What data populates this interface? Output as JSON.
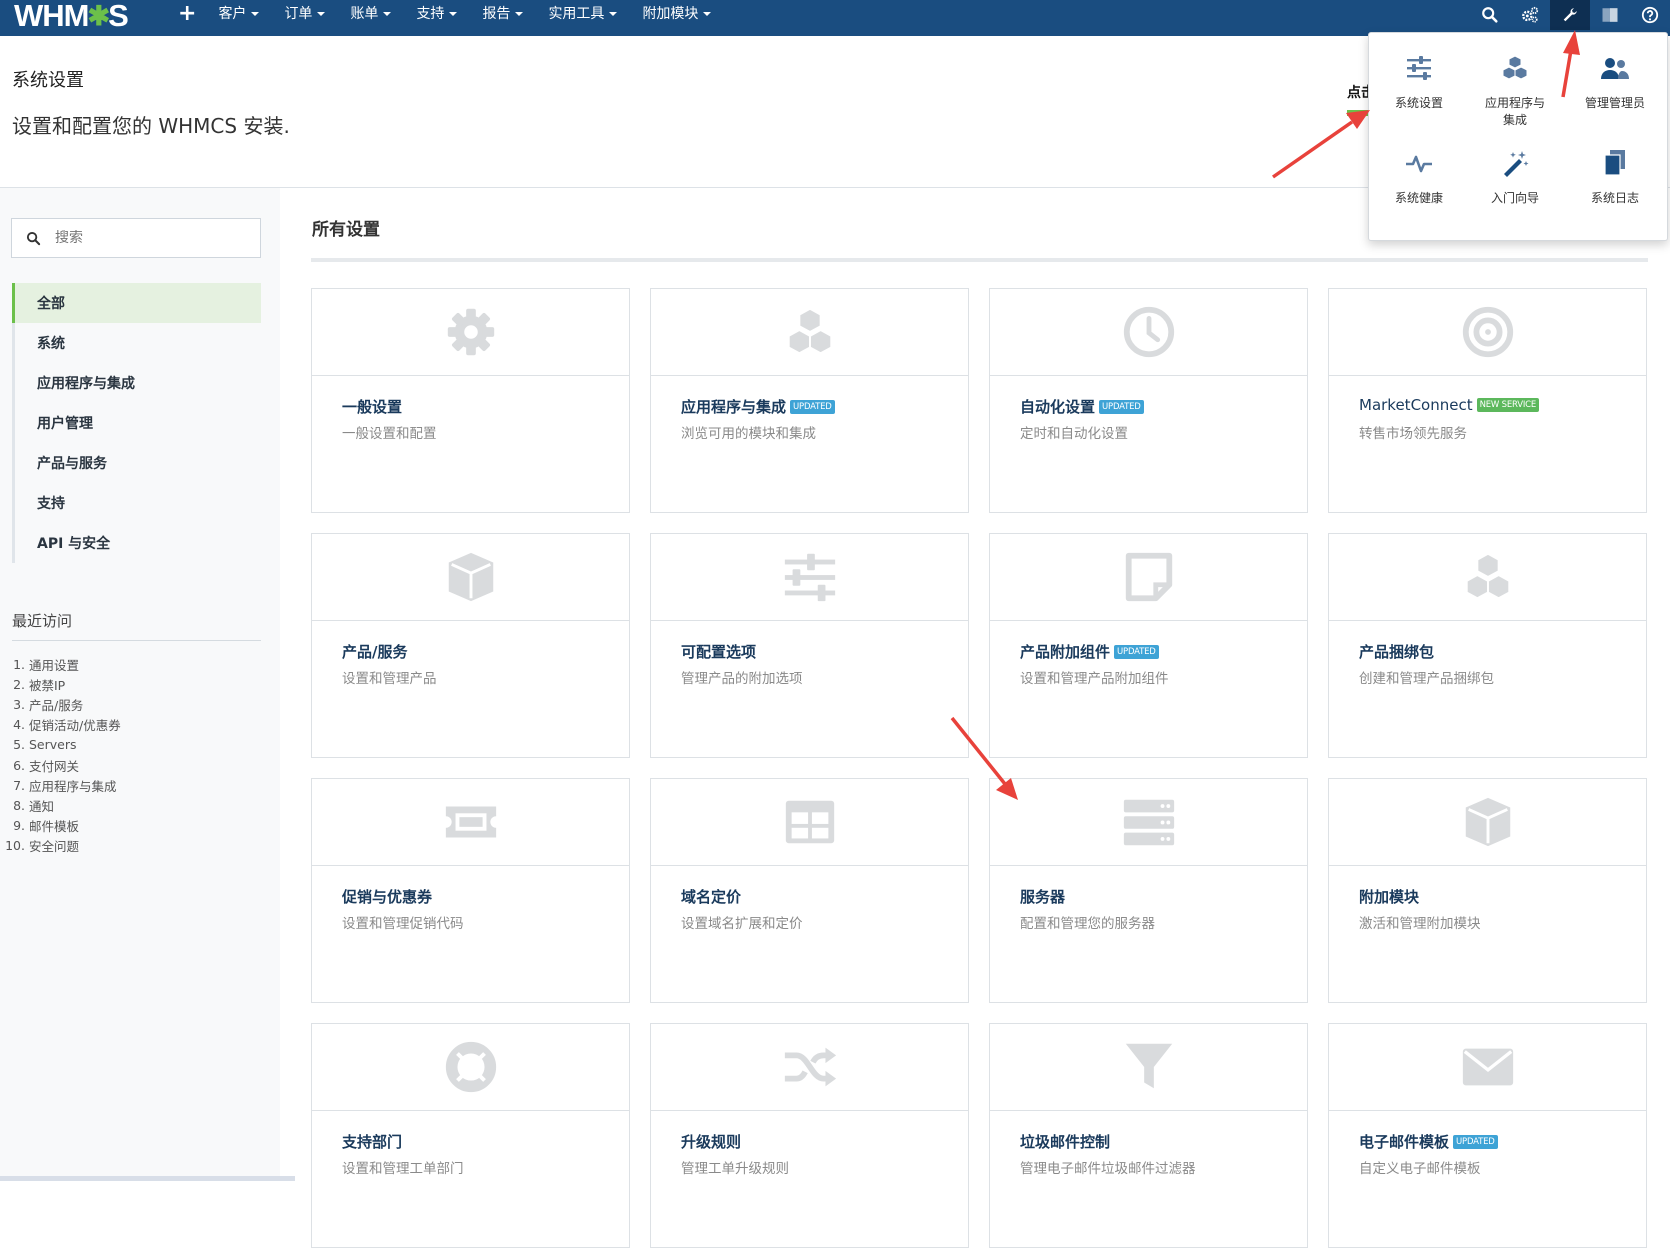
{
  "nav": {
    "logo_text_left": "WHM",
    "logo_text_right": "S",
    "plus": "+",
    "menus": [
      "客户",
      "订单",
      "账单",
      "支持",
      "报告",
      "实用工具",
      "附加模块"
    ],
    "icons": [
      "search-icon",
      "cogs-icon",
      "wrench-icon",
      "profile-icon",
      "help-icon"
    ]
  },
  "header": {
    "title": "系统设置",
    "description": "设置和配置您的 WHMCS 安装.",
    "hint": "点击"
  },
  "sidebar": {
    "search_placeholder": "搜索",
    "categories": [
      "全部",
      "系统",
      "应用程序与集成",
      "用户管理",
      "产品与服务",
      "支持",
      "API 与安全"
    ],
    "active_category": "全部",
    "recent_title": "最近访问",
    "recent": [
      {
        "num": "1.",
        "label": "通用设置"
      },
      {
        "num": "2.",
        "label": "被禁IP"
      },
      {
        "num": "3.",
        "label": "产品/服务"
      },
      {
        "num": "4.",
        "label": "促销活动/优惠券"
      },
      {
        "num": "5.",
        "label": "Servers"
      },
      {
        "num": "6.",
        "label": "支付网关"
      },
      {
        "num": "7.",
        "label": "应用程序与集成"
      },
      {
        "num": "8.",
        "label": "通知"
      },
      {
        "num": "9.",
        "label": "邮件模板"
      },
      {
        "num": "10.",
        "label": "安全问题"
      }
    ]
  },
  "main": {
    "title": "所有设置",
    "cards": [
      {
        "icon": "gear-icon",
        "title": "一般设置",
        "subtitle": "一般设置和配置",
        "badge": ""
      },
      {
        "icon": "cubes-icon",
        "title": "应用程序与集成",
        "subtitle": "浏览可用的模块和集成",
        "badge": "UPDATED"
      },
      {
        "icon": "clock-icon",
        "title": "自动化设置",
        "subtitle": "定时和自动化设置",
        "badge": "UPDATED"
      },
      {
        "icon": "target-icon",
        "title": "MarketConnect",
        "subtitle": "转售市场领先服务",
        "badge": "NEW SERVICE"
      },
      {
        "icon": "cube-icon",
        "title": "产品/服务",
        "subtitle": "设置和管理产品",
        "badge": ""
      },
      {
        "icon": "sliders-icon",
        "title": "可配置选项",
        "subtitle": "管理产品的附加选项",
        "badge": ""
      },
      {
        "icon": "sticky-note-icon",
        "title": "产品附加组件",
        "subtitle": "设置和管理产品附加组件",
        "badge": "UPDATED"
      },
      {
        "icon": "cubes-icon",
        "title": "产品捆绑包",
        "subtitle": "创建和管理产品捆绑包",
        "badge": ""
      },
      {
        "icon": "ticket-icon",
        "title": "促销与优惠券",
        "subtitle": "设置和管理促销代码",
        "badge": ""
      },
      {
        "icon": "table-icon",
        "title": "域名定价",
        "subtitle": "设置域名扩展和定价",
        "badge": ""
      },
      {
        "icon": "server-icon",
        "title": "服务器",
        "subtitle": "配置和管理您的服务器",
        "badge": ""
      },
      {
        "icon": "cube-icon",
        "title": "附加模块",
        "subtitle": "激活和管理附加模块",
        "badge": ""
      },
      {
        "icon": "life-ring-icon",
        "title": "支持部门",
        "subtitle": "设置和管理工单部门",
        "badge": ""
      },
      {
        "icon": "random-icon",
        "title": "升级规则",
        "subtitle": "管理工单升级规则",
        "badge": ""
      },
      {
        "icon": "filter-icon",
        "title": "垃圾邮件控制",
        "subtitle": "管理电子邮件垃圾邮件过滤器",
        "badge": ""
      },
      {
        "icon": "envelope-icon",
        "title": "电子邮件模板",
        "subtitle": "自定义电子邮件模板",
        "badge": "UPDATED"
      }
    ]
  },
  "dropdown": {
    "items": [
      {
        "icon": "sliders-icon",
        "label": "系统设置"
      },
      {
        "icon": "cubes-icon",
        "label": "应用程序与集成"
      },
      {
        "icon": "users-icon",
        "label": "管理管理员"
      },
      {
        "icon": "heartbeat-icon",
        "label": "系统健康"
      },
      {
        "icon": "magic-icon",
        "label": "入门向导"
      },
      {
        "icon": "files-icon",
        "label": "系统日志"
      }
    ]
  },
  "colors": {
    "nav_bg": "#1a4d80",
    "accent_green": "#6cc04a",
    "badge_updated": "#3ea3d6",
    "badge_new": "#5cb85c",
    "icon_gray": "#d9dbdd",
    "icon_blue": "#5a7aa0",
    "annotation_red": "#e8423b"
  }
}
